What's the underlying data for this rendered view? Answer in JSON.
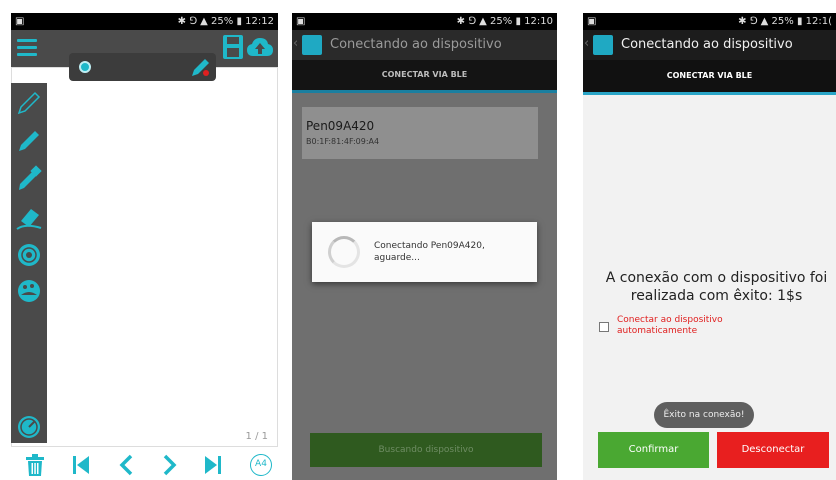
{
  "status": {
    "screen1": {
      "icons": "✱ ⅁ ▲",
      "battery": "25%",
      "time": "12:12"
    },
    "screen2": {
      "icons": "✱ ⅁ ▲",
      "battery": "25%",
      "time": "12:10"
    },
    "screen3": {
      "icons": "✱ ⅁ ▲",
      "battery": "25%",
      "time": "12:1("
    }
  },
  "screen1": {
    "page_counter": "1 / 1",
    "paper_size": "A4",
    "accent_color": "#1fb8c9"
  },
  "screen2": {
    "title": "Conectando ao dispositivo",
    "tab": "CONECTAR VIA BLE",
    "device_name": "Pen09A420",
    "device_mac": "B0:1F:81:4F:09:A4",
    "dialog_message": "Conectando Pen09A420, aguarde...",
    "search_button": "Buscando dispositivo"
  },
  "screen3": {
    "title": "Conectando ao dispositivo",
    "tab": "CONECTAR VIA BLE",
    "success_message": "A conexão com o dispositivo foi realizada com êxito: 1$s",
    "auto_connect_label": "Conectar ao dispositivo automaticamente",
    "toast": "Êxito na conexão!",
    "confirm_button": "Confirmar",
    "disconnect_button": "Desconectar"
  }
}
